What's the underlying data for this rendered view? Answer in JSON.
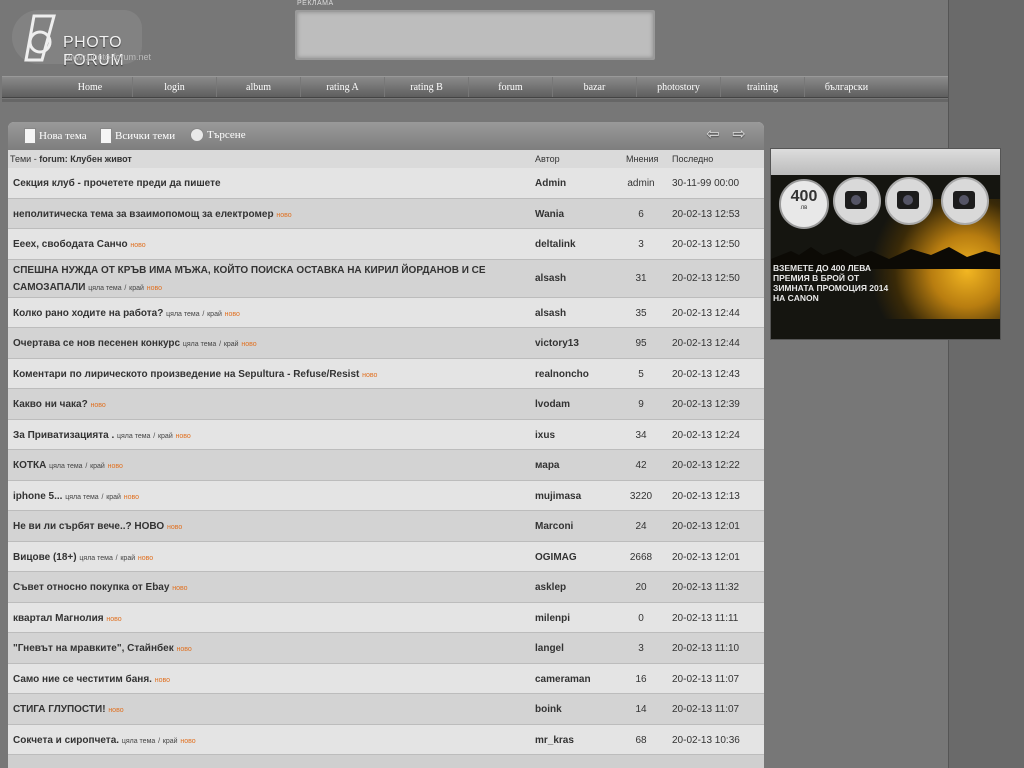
{
  "logo": {
    "title": "PHOTO FORUM",
    "url": "www.photo-forum.net"
  },
  "ad": {
    "label": "РЕКЛАМА"
  },
  "nav": [
    "Home",
    "login",
    "album",
    "rating A",
    "rating B",
    "forum",
    "bazar",
    "photostory",
    "training",
    "български"
  ],
  "toolbar": {
    "new_topic": "Нова тема",
    "all_topics": "Всички теми",
    "search": "Търсене"
  },
  "table": {
    "topics_label": "Теми",
    "sep": " - ",
    "forum_name": "forum: Клубен живот",
    "col_author": "Автор",
    "col_opinions": "Мнения",
    "col_last": "Последно"
  },
  "labels": {
    "whole": "цяла тема",
    "end": "край",
    "new": "ново"
  },
  "rows": [
    {
      "title": "Секция клуб - прочетете преди да пишете",
      "author": "Admin",
      "opinions": "admin",
      "last": "30-11-99 00:00"
    },
    {
      "title": "неполитическа тема за взаимопомощ за електромер",
      "author": "Wania",
      "opinions": "6",
      "last": "20-02-13 12:53"
    },
    {
      "title": "Ееех, свободата Санчо",
      "author": "deltalink",
      "opinions": "3",
      "last": "20-02-13 12:50"
    },
    {
      "title": "СПЕШНА НУЖДА ОТ КРЪВ ИМА МЪЖА, КОЙТО ПОИСКА ОСТАВКА НА КИРИЛ ЙОРДАНОВ И СЕ САМОЗАПАЛИ",
      "author": "alsash",
      "opinions": "31",
      "last": "20-02-13 12:50"
    },
    {
      "title": "Колко рано ходите на работа?",
      "author": "alsash",
      "opinions": "35",
      "last": "20-02-13 12:44"
    },
    {
      "title": "Очертава се нов песенен конкурс",
      "author": "victory13",
      "opinions": "95",
      "last": "20-02-13 12:44"
    },
    {
      "title": "Коментари по лирическото произведение на Sepultura - Refuse/Resist",
      "author": "realnoncho",
      "opinions": "5",
      "last": "20-02-13 12:43"
    },
    {
      "title": "Какво ни чака?",
      "author": "lvodam",
      "opinions": "9",
      "last": "20-02-13 12:39"
    },
    {
      "title": "За Приватизацията .",
      "author": "ixus",
      "opinions": "34",
      "last": "20-02-13 12:24"
    },
    {
      "title": "КОТКА",
      "author": "мара",
      "opinions": "42",
      "last": "20-02-13 12:22"
    },
    {
      "title": "iphone 5...",
      "author": "mujimasa",
      "opinions": "3220",
      "last": "20-02-13 12:13"
    },
    {
      "title": "Не ви ли сърбят вече..? НОВО",
      "author": "Marconi",
      "opinions": "24",
      "last": "20-02-13 12:01"
    },
    {
      "title": "Вицове (18+)",
      "author": "OGIMAG",
      "opinions": "2668",
      "last": "20-02-13 12:01"
    },
    {
      "title": "Съвет относно покупка от Ebay",
      "author": "asklep",
      "opinions": "20",
      "last": "20-02-13 11:32"
    },
    {
      "title": "квартал Магнолия",
      "author": "milenpi",
      "opinions": "0",
      "last": "20-02-13 11:11"
    },
    {
      "title": "\"Гневът на мравките\", Стайнбек",
      "author": "langel",
      "opinions": "3",
      "last": "20-02-13 11:10"
    },
    {
      "title": "Само ние се честитим баня.",
      "author": "cameraman",
      "opinions": "16",
      "last": "20-02-13 11:07"
    },
    {
      "title": "СТИГА ГЛУПОСТИ!",
      "author": "boink",
      "opinions": "14",
      "last": "20-02-13 11:07"
    },
    {
      "title": "Сокчета и сиропчета.",
      "author": "mr_kras",
      "opinions": "68",
      "last": "20-02-13 10:36"
    }
  ],
  "promo": {
    "amount": "400",
    "currency": "лв",
    "line1": "ВЗЕМЕТЕ ДО 400 ЛЕВА",
    "line2": "ПРЕМИЯ В БРОЙ ОТ",
    "line3": "ЗИМНАТА ПРОМОЦИЯ 2014",
    "line4": "НА CANON"
  }
}
